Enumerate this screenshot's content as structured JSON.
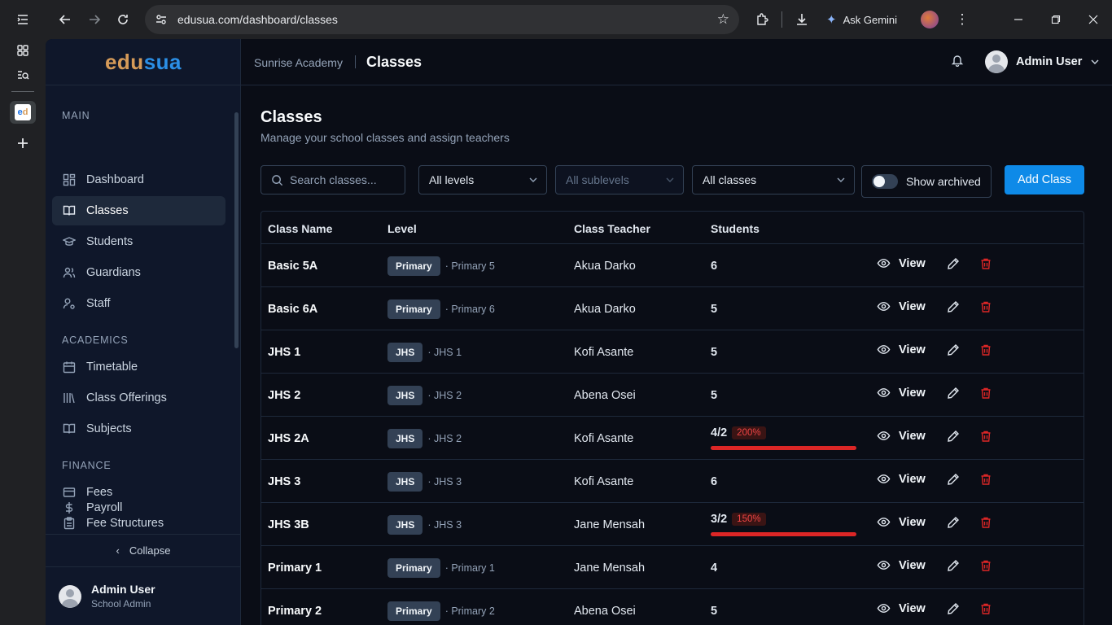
{
  "browser": {
    "url": "edusua.com/dashboard/classes",
    "ask_gemini": "Ask Gemini"
  },
  "sidebar": {
    "brand_part1": "edu",
    "brand_part2": "sua",
    "sections": [
      {
        "label": "MAIN"
      },
      {
        "label": "ACADEMICS"
      },
      {
        "label": "FINANCE"
      }
    ],
    "items": [
      {
        "label": "Dashboard",
        "icon": "dashboard-icon"
      },
      {
        "label": "Classes",
        "icon": "book-icon"
      },
      {
        "label": "Students",
        "icon": "graduation-cap-icon"
      },
      {
        "label": "Guardians",
        "icon": "users-icon"
      },
      {
        "label": "Staff",
        "icon": "user-cog-icon"
      },
      {
        "label": "Timetable",
        "icon": "calendar-icon"
      },
      {
        "label": "Class Offerings",
        "icon": "library-icon"
      },
      {
        "label": "Subjects",
        "icon": "book-open-icon"
      },
      {
        "label": "Fees",
        "icon": "wallet-icon"
      },
      {
        "label": "Fee Structures",
        "icon": "clipboard-icon"
      },
      {
        "label": "Payroll",
        "icon": "dollar-icon"
      }
    ],
    "collapse_label": "Collapse",
    "user_name": "Admin User",
    "user_role": "School Admin"
  },
  "header": {
    "school": "Sunrise Academy",
    "page": "Classes",
    "user_name": "Admin User"
  },
  "main": {
    "title": "Classes",
    "subtitle": "Manage your school classes and assign teachers",
    "search_placeholder": "Search classes...",
    "level_filter": "All levels",
    "sublevel_filter": "All sublevels",
    "class_filter": "All classes",
    "show_archived": "Show archived",
    "add_button": "Add Class",
    "columns": [
      "Class Name",
      "Level",
      "Class Teacher",
      "Students"
    ],
    "view_label": "View",
    "rows": [
      {
        "name": "Basic 5A",
        "level": "Primary",
        "sublevel": "· Primary 5",
        "teacher": "Akua Darko",
        "students": "6"
      },
      {
        "name": "Basic 6A",
        "level": "Primary",
        "sublevel": "· Primary 6",
        "teacher": "Akua Darko",
        "students": "5"
      },
      {
        "name": "JHS 1",
        "level": "JHS",
        "sublevel": "· JHS 1",
        "teacher": "Kofi Asante",
        "students": "5"
      },
      {
        "name": "JHS 2",
        "level": "JHS",
        "sublevel": "· JHS 2",
        "teacher": "Abena Osei",
        "students": "5"
      },
      {
        "name": "JHS 2A",
        "level": "JHS",
        "sublevel": "· JHS 2",
        "teacher": "Kofi Asante",
        "students": "4/2",
        "capacity_pct": "200%",
        "fill": 1.0
      },
      {
        "name": "JHS 3",
        "level": "JHS",
        "sublevel": "· JHS 3",
        "teacher": "Kofi Asante",
        "students": "6"
      },
      {
        "name": "JHS 3B",
        "level": "JHS",
        "sublevel": "· JHS 3",
        "teacher": "Jane Mensah",
        "students": "3/2",
        "capacity_pct": "150%",
        "fill": 1.0
      },
      {
        "name": "Primary 1",
        "level": "Primary",
        "sublevel": "· Primary 1",
        "teacher": "Jane Mensah",
        "students": "4"
      },
      {
        "name": "Primary 2",
        "level": "Primary",
        "sublevel": "· Primary 2",
        "teacher": "Abena Osei",
        "students": "5"
      }
    ]
  },
  "colors": {
    "accent": "#0e8ae8",
    "brand_edu": "#d69b58",
    "brand_sua": "#2b8fe6",
    "danger": "#dc2626"
  }
}
